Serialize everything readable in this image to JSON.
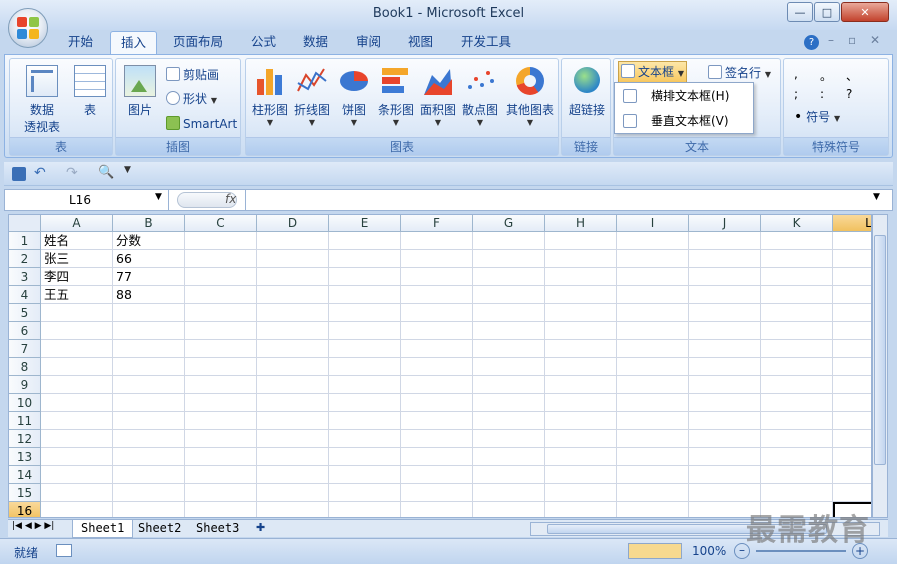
{
  "window": {
    "title": "Book1 - Microsoft Excel",
    "min": "—",
    "restore": "□",
    "close": "✕"
  },
  "tabs": [
    "开始",
    "插入",
    "页面布局",
    "公式",
    "数据",
    "审阅",
    "视图",
    "开发工具"
  ],
  "active_tab": "插入",
  "ribbon": {
    "groups": {
      "tables": "表",
      "illustrations": "插图",
      "charts": "图表",
      "links": "链接",
      "text": "文本",
      "symbols": "特殊符号"
    },
    "pivot": "数据",
    "pivot2": "透视表",
    "table": "表",
    "picture": "图片",
    "clipart": "剪贴画",
    "shapes": "形状",
    "smartart": "SmartArt",
    "charts": [
      "柱形图",
      "折线图",
      "饼图",
      "条形图",
      "面积图",
      "散点图",
      "其他图表"
    ],
    "hyperlink": "超链接",
    "textbox": "文本框",
    "signature": "签名行",
    "symbol": "符号",
    "punct": [
      ",",
      "。",
      "、",
      ";",
      ":",
      "?"
    ]
  },
  "textbox_menu": [
    "横排文本框(H)",
    "垂直文本框(V)"
  ],
  "formula": {
    "namebox": "L16",
    "fx": "fx"
  },
  "columns": [
    "A",
    "B",
    "C",
    "D",
    "E",
    "F",
    "G",
    "H",
    "I",
    "J",
    "K",
    "L"
  ],
  "rows": [
    "1",
    "2",
    "3",
    "4",
    "5",
    "6",
    "7",
    "8",
    "9",
    "10",
    "11",
    "12",
    "13",
    "14",
    "15",
    "16"
  ],
  "cells": [
    [
      "姓名",
      "分数"
    ],
    [
      "张三",
      "66"
    ],
    [
      "李四",
      "77"
    ],
    [
      "王五",
      "88"
    ]
  ],
  "sheets": [
    "Sheet1",
    "Sheet2",
    "Sheet3"
  ],
  "status": {
    "ready": "就绪",
    "zoom": "100%"
  },
  "watermark": "最需教育"
}
